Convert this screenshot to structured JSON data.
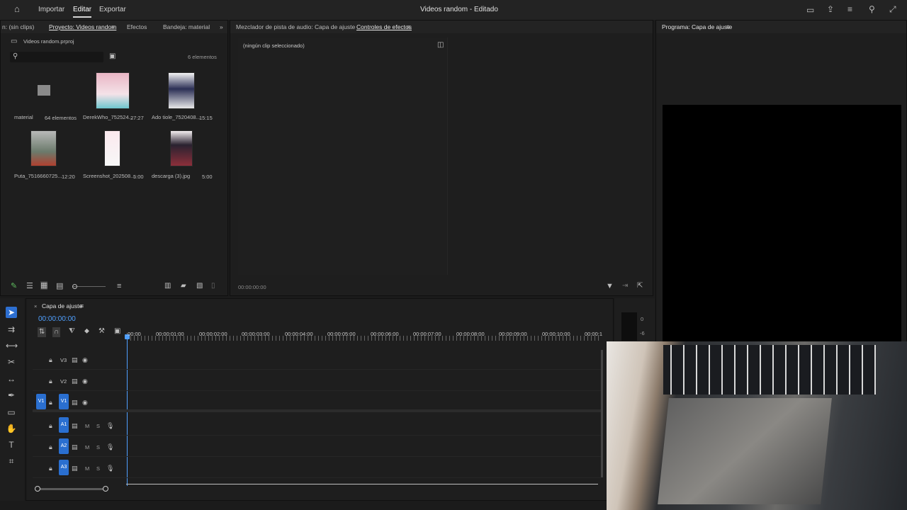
{
  "topbar": {
    "menu": [
      "Importar",
      "Editar",
      "Exportar"
    ],
    "active_menu": "Editar",
    "title": "Videos random",
    "title_suffix": "- Editado"
  },
  "project_panel": {
    "tabs": [
      "n: (sin clips)",
      "Proyecto: Videos random",
      "Efectos",
      "Bandeja: material"
    ],
    "file": "Videos random.prproj",
    "count": "6 elementos",
    "items": [
      {
        "name": "material",
        "info": "64 elementos",
        "kind": "folder"
      },
      {
        "name": "DerekWho_752524...",
        "info": "27:27",
        "kind": "video"
      },
      {
        "name": "Ado tiole_7520408...",
        "info": "15:15",
        "kind": "video"
      },
      {
        "name": "Puta_7516660725...",
        "info": "12:20",
        "kind": "video"
      },
      {
        "name": "Screenshot_202508...",
        "info": "5:00",
        "kind": "image"
      },
      {
        "name": "descarga (3).jpg",
        "info": "5:00",
        "kind": "image"
      }
    ]
  },
  "effects_panel": {
    "tabs": [
      "Mezclador de pista de audio: Capa de ajuste",
      "Controles de efectos"
    ],
    "no_clip": "(ningún clip seleccionado)",
    "timecode": "00:00:00:00"
  },
  "program_panel": {
    "title": "Programa: Capa de ajuste"
  },
  "timeline": {
    "sequence": "Capa de ajuste",
    "timecode": "00:00:00:00",
    "ruler": [
      ":00:00",
      "00:00:01:00",
      "00:00:02:00",
      "00:00:03:00",
      "00:00:04:00",
      "00:00:05:00",
      "00:00:06:00",
      "00:00:07:00",
      "00:00:08:00",
      "00:00:09:00",
      "00:00:10:00",
      "00:00:1"
    ],
    "video_tracks": [
      "V3",
      "V2",
      "V1"
    ],
    "audio_tracks": [
      "A1",
      "A2",
      "A3"
    ],
    "source_targets": [
      "V1",
      "A1",
      "A2",
      "A3"
    ],
    "mute_label": "M",
    "solo_label": "S",
    "meter_labels": [
      "0",
      "-6"
    ]
  }
}
